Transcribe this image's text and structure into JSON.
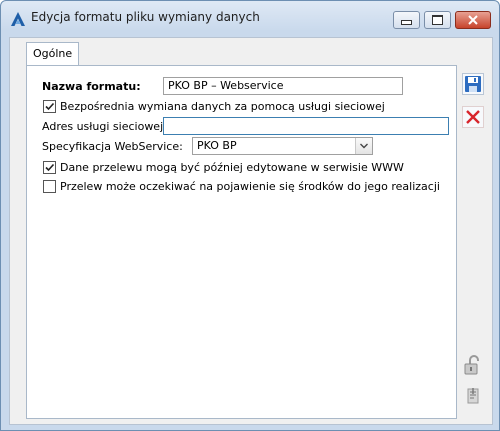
{
  "window": {
    "title": "Edycja formatu pliku wymiany danych",
    "accent_color": "#1f5fa8",
    "close_color": "#c7432b"
  },
  "tabs": [
    {
      "label": "Ogólne",
      "active": true
    }
  ],
  "form": {
    "format_name_label": "Nazwa formatu:",
    "format_name_value": "PKO BP – Webservice",
    "direct_exchange_label": "Bezpośrednia wymiana danych za pomocą usługi sieciowej",
    "direct_exchange_checked": true,
    "service_address_label": "Adres usługi sieciowej:",
    "service_address_value": "",
    "webservice_spec_label": "Specyfikacja WebService:",
    "webservice_spec_value": "PKO BP",
    "editable_transfer_label": "Dane przelewu mogą być później edytowane w serwisie WWW",
    "editable_transfer_checked": true,
    "wait_funds_label": "Przelew może oczekiwać na pojawienie się środków do jego realizacji",
    "wait_funds_checked": false
  },
  "toolbar": {
    "save_icon": "save-icon",
    "cancel_icon": "cancel-icon",
    "lock_icon": "lock-icon",
    "attach_icon": "attach-icon"
  }
}
